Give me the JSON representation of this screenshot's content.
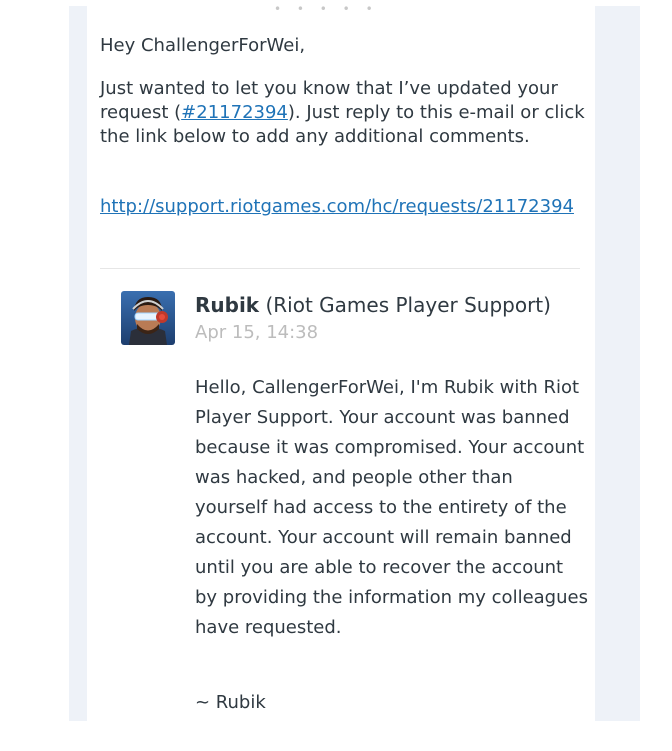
{
  "email": {
    "greeting": "Hey ChallengerForWei,",
    "intro_before": "Just wanted to let you know that I’ve updated your request (",
    "request_link": "#21172394",
    "intro_after": "). Just reply to this e-mail or click the link below to add any additional comments.",
    "request_url": "http://support.riotgames.com/hc/requests/21172394"
  },
  "comment": {
    "author_name": "Rubik",
    "author_org": "(Riot Games Player Support)",
    "timestamp": "Apr 15, 14:38",
    "body": "Hello, CallengerForWei, I'm Rubik with Riot Player Support. Your account was banned because it was compromised. Your account was hacked, and people other than yourself had access to the entirety of the account. Your account will remain banned until you are able to recover the account by providing the information my colleagues have requested.",
    "signature": "~ Rubik"
  },
  "colors": {
    "link": "#1f73b7",
    "text": "#2f3941",
    "timestamp": "#bcbcbc",
    "panel": "#eef2f8"
  },
  "icons": {
    "avatar": "support-agent-avatar"
  }
}
